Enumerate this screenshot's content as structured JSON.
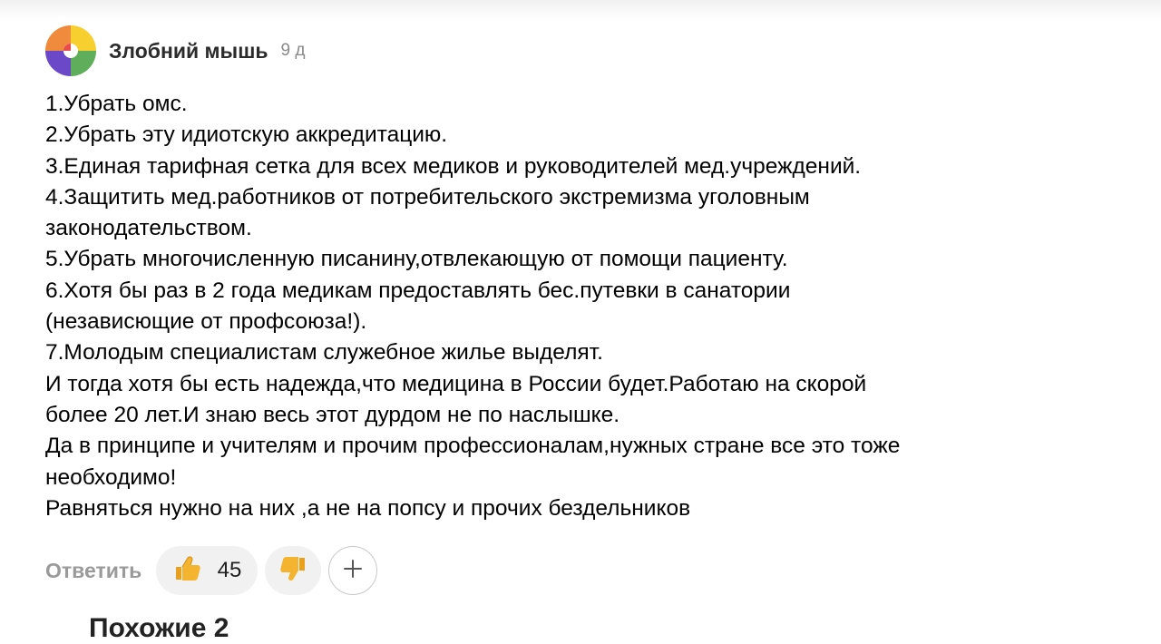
{
  "comment": {
    "author": "Злобний мышь",
    "time": "9 д",
    "lines": [
      "1.Убрать омс.",
      "2.Убрать эту идиотскую аккредитацию.",
      "3.Единая тарифная сетка для всех медиков и руководителей мед.учреждений.",
      "4.Защитить мед.работников от потребительского экстремизма уголовным",
      "законодательством.",
      "5.Убрать многочисленную писанину,отвлекающую от помощи пациенту.",
      "6.Хотя бы раз в 2 года медикам предоставлять бес.путевки в санатории",
      "(независющие от профсоюза!).",
      "7.Молодым специалистам служебное жилье выделят.",
      "И тогда хотя бы есть надежда,что медицина в России будет.Работаю на скорой",
      "более 20 лет.И знаю весь этот дурдом не по наслышке.",
      "Да в принципе и учителям и прочим профессионалам,нужных стране все это тоже",
      "необходимо!",
      "Равняться нужно на них ,а не на попсу и прочих бездельников"
    ],
    "actions": {
      "reply_label": "Ответить",
      "like_count": "45"
    }
  },
  "next_section_partial": "Похожие 2",
  "icons": {
    "like": "thumbs-up-icon",
    "dislike": "thumbs-down-icon",
    "add": "plus-icon"
  },
  "colors": {
    "author": "#2b2b2b",
    "muted": "#8a8a8a",
    "pill_bg": "#f1f1f1",
    "thumb": "#f5b430"
  }
}
